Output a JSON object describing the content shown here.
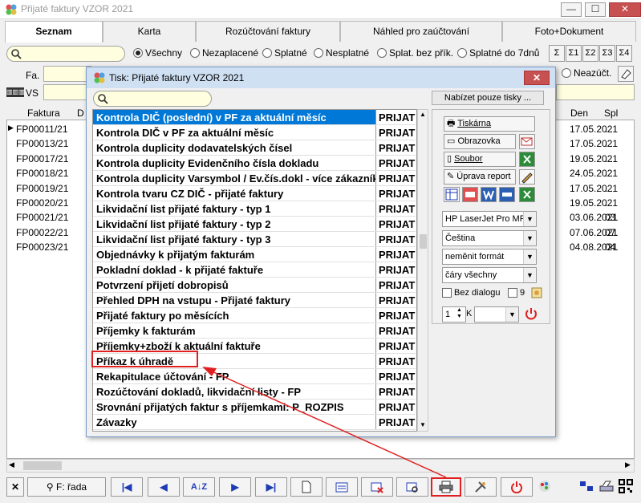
{
  "window": {
    "title": "Přijaté faktury VZOR  2021",
    "minimize": "—",
    "maximize": "☐",
    "close": "✕"
  },
  "tabs": [
    "Seznam",
    "Karta",
    "Rozúčtování faktury",
    "Náhled pro zaúčtování",
    "Foto+Dokument"
  ],
  "filter": {
    "radios": [
      "Všechny",
      "Nezaplacené",
      "Splatné",
      "Nesplatné",
      "Splat. bez přík.",
      "Splatné do 7dnů"
    ],
    "selected_radio": "Všechny",
    "sum_buttons": [
      "Σ",
      "Σ1",
      "Σ2",
      "Σ3",
      "Σ4"
    ],
    "fa_label": "Fa.",
    "vs_label": "VS",
    "neazuct_label": "Neazúčt."
  },
  "grid": {
    "headers": [
      "Faktura",
      "D",
      "Den",
      "Spl"
    ],
    "rows": [
      {
        "faktura": "FP00011/21",
        "den": "17.05.2021",
        "spl": ". ."
      },
      {
        "faktura": "FP00013/21",
        "den": "17.05.2021",
        "spl": ". ."
      },
      {
        "faktura": "FP00017/21",
        "den": "19.05.2021",
        "spl": ". ."
      },
      {
        "faktura": "FP00018/21",
        "den": "24.05.2021",
        "spl": ". ."
      },
      {
        "faktura": "FP00019/21",
        "den": "17.05.2021",
        "spl": ". ."
      },
      {
        "faktura": "FP00020/21",
        "den": "19.05.2021",
        "spl": ". ."
      },
      {
        "faktura": "FP00021/21",
        "den": "03.06.2021",
        "spl": "03."
      },
      {
        "faktura": "FP00022/21",
        "den": "07.06.2021",
        "spl": "07."
      },
      {
        "faktura": "FP00023/21",
        "den": "04.08.2021",
        "spl": "04."
      }
    ]
  },
  "toolbar": {
    "close": "✕",
    "rada": "F: řada",
    "first": "|◀",
    "prev": "◀",
    "sort": "A↓Z",
    "next": "▶",
    "last": "▶|"
  },
  "dialog": {
    "title": "Tisk: Přijaté faktury VZOR  2021",
    "close": "✕",
    "offer_button": "Nabízet pouze tisky ...",
    "items": [
      {
        "name": "Kontrola DIČ (poslední) v PF za aktuální měsíc",
        "type": "PRIJAT"
      },
      {
        "name": "Kontrola DIČ v PF za aktuální měsíc",
        "type": "PRIJAT"
      },
      {
        "name": "Kontrola duplicity dodavatelských čísel",
        "type": "PRIJAT"
      },
      {
        "name": "Kontrola duplicity Evidenčního čísla dokladu",
        "type": "PRIJAT"
      },
      {
        "name": "Kontrola duplicity Varsymbol / Ev.čís.dokl - více zákazníků",
        "type": "PRIJAT"
      },
      {
        "name": "Kontrola tvaru CZ DIČ - přijaté faktury",
        "type": "PRIJAT"
      },
      {
        "name": "Likvidační list přijaté faktury - typ 1",
        "type": "PRIJAT"
      },
      {
        "name": "Likvidační list přijaté faktury - typ 2",
        "type": "PRIJAT"
      },
      {
        "name": "Likvidační list přijaté faktury - typ 3",
        "type": "PRIJAT"
      },
      {
        "name": "Objednávky k přijatým fakturám",
        "type": "PRIJAT"
      },
      {
        "name": "Pokladní doklad - k přijaté faktuře",
        "type": "PRIJAT"
      },
      {
        "name": "Potvrzení přijetí dobropisů",
        "type": "PRIJAT"
      },
      {
        "name": "Přehled DPH na vstupu - Přijaté faktury",
        "type": "PRIJAT"
      },
      {
        "name": "Přijaté faktury po měsících",
        "type": "PRIJAT"
      },
      {
        "name": "Příjemky k fakturám",
        "type": "PRIJAT"
      },
      {
        "name": "Příjemky+zboží k aktuální faktuře",
        "type": "PRIJAT"
      },
      {
        "name": "Příkaz k úhradě",
        "type": "PRIJAT"
      },
      {
        "name": "Rekapitulace účtování - FP",
        "type": "PRIJAT"
      },
      {
        "name": "Rozúčtování dokladů, likvidační listy - FP",
        "type": "PRIJAT"
      },
      {
        "name": "Srovnání přijatých faktur s příjemkami: P_ROZPIS",
        "type": "PRIJAT"
      },
      {
        "name": "Závazky",
        "type": "PRIJAT"
      }
    ],
    "panel": {
      "printer": "Tiskárna",
      "screen": "Obrazovka",
      "file": "Soubor",
      "edit_report": "Úprava report",
      "printer_combo": "HP LaserJet Pro MFP",
      "language_combo": "Čeština",
      "format_combo": "neměnit formát",
      "lines_combo": "čáry všechny",
      "no_dialog": "Bez dialogu",
      "copies": "9",
      "count": "1",
      "k_label": "K"
    }
  },
  "colors": {
    "accent": "#0078d7",
    "highlight": "#e02020",
    "field": "#ffffe0"
  }
}
